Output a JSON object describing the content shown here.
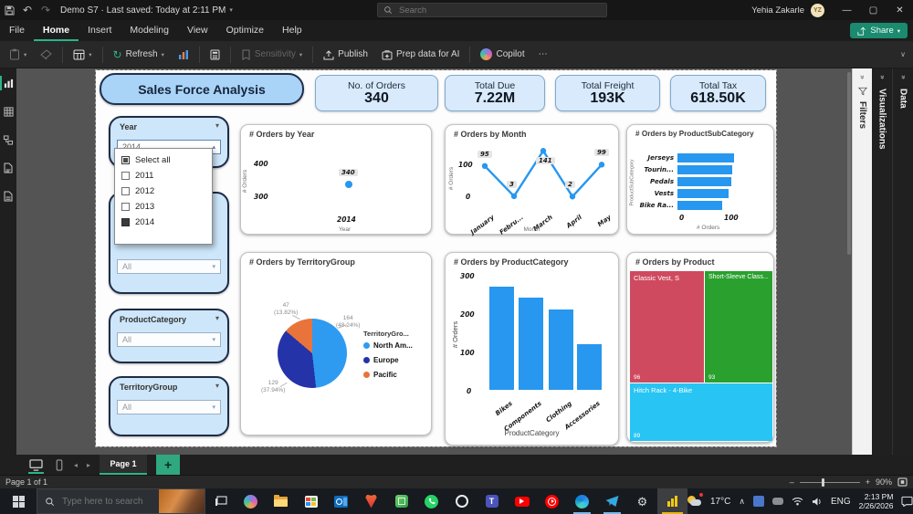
{
  "titlebar": {
    "doc_title": "Demo S7 · Last saved: Today at 2:11 PM",
    "search_placeholder": "Search",
    "user_name": "Yehia Zakarle",
    "user_initials": "YZ"
  },
  "menu": {
    "items": [
      {
        "label": "File"
      },
      {
        "label": "Home"
      },
      {
        "label": "Insert"
      },
      {
        "label": "Modeling"
      },
      {
        "label": "View"
      },
      {
        "label": "Optimize"
      },
      {
        "label": "Help"
      }
    ],
    "share_label": "Share"
  },
  "ribbon": {
    "refresh": "Refresh",
    "sensitivity": "Sensitivity",
    "publish": "Publish",
    "prep_ai": "Prep data for AI",
    "copilot": "Copilot",
    "more": "⋯"
  },
  "report": {
    "title": "Sales Force Analysis",
    "kpis": [
      {
        "label": "No. of Orders",
        "value": "340"
      },
      {
        "label": "Total Due",
        "value": "7.22M"
      },
      {
        "label": "Total Freight",
        "value": "193K"
      },
      {
        "label": "Total Tax",
        "value": "618.50K"
      }
    ],
    "slicers": {
      "year": {
        "title": "Year",
        "value": "2014",
        "options": [
          {
            "label": "Select all",
            "state": "partial"
          },
          {
            "label": "2011",
            "state": "empty"
          },
          {
            "label": "2012",
            "state": "empty"
          },
          {
            "label": "2013",
            "state": "empty"
          },
          {
            "label": "2014",
            "state": "checked"
          }
        ]
      },
      "hidden": {
        "value": "All"
      },
      "product_category": {
        "title": "ProductCategory",
        "value": "All"
      },
      "territory_group": {
        "title": "TerritoryGroup",
        "value": "All"
      }
    }
  },
  "chart_data": [
    {
      "type": "scatter",
      "title": "# Orders by Year",
      "xlabel": "Year",
      "ylabel": "# Orders",
      "x": [
        "2014"
      ],
      "y": [
        340
      ],
      "yticks": [
        "400",
        "300"
      ],
      "ylim": [
        250,
        450
      ]
    },
    {
      "type": "line",
      "title": "# Orders by Month",
      "xlabel": "Month",
      "ylabel": "# Orders",
      "categories": [
        "January",
        "Febru...",
        "March",
        "April",
        "May"
      ],
      "values": [
        95,
        3,
        141,
        2,
        99
      ],
      "yticks": [
        "100",
        "0"
      ],
      "ylim": [
        0,
        160
      ]
    },
    {
      "type": "bar",
      "title": "# Orders by ProductSubCategory",
      "xlabel": "# Orders",
      "ylabel": "ProductSubCategory",
      "categories": [
        "Jerseys",
        "Tourin...",
        "Pedals",
        "Vests",
        "Bike Ra..."
      ],
      "values": [
        110,
        108,
        106,
        100,
        87
      ],
      "xticks": [
        "0",
        "100"
      ],
      "xlim": [
        0,
        117
      ]
    },
    {
      "type": "pie",
      "title": "# Orders by TerritoryGroup",
      "legend_title": "TerritoryGro...",
      "slices": [
        {
          "label": "North Am...",
          "value": 164,
          "pct": "(48.24%)",
          "color": "#2e9bf0"
        },
        {
          "label": "Europe",
          "value": 129,
          "pct": "(37.94%)",
          "color": "#2433a8"
        },
        {
          "label": "Pacific",
          "value": 47,
          "pct": "(13.82%)",
          "color": "#e8743b"
        }
      ]
    },
    {
      "type": "column",
      "title": "# Orders by ProductCategory",
      "xlabel": "ProductCategory",
      "ylabel": "# Orders",
      "categories": [
        "Bikes",
        "Components",
        "Clothing",
        "Accessories"
      ],
      "values": [
        270,
        240,
        210,
        120
      ],
      "yticks": [
        "300",
        "200",
        "100",
        "0"
      ],
      "ylim": [
        0,
        300
      ]
    },
    {
      "type": "treemap",
      "title": "# Orders by Product",
      "items": [
        {
          "label": "Classic Vest, S",
          "value": 96,
          "color": "#cf4a5f"
        },
        {
          "label": "Short-Sleeve Class...",
          "value": 93,
          "color": "#2aa12e"
        },
        {
          "label": "Hitch Rack - 4-Bike",
          "value": 89,
          "color": "#27c4f4"
        }
      ]
    }
  ],
  "panes": {
    "filters": "Filters",
    "visualizations": "Visualizations",
    "data": "Data"
  },
  "pagebar": {
    "tab": "Page 1"
  },
  "statusbar": {
    "page_info": "Page 1 of 1",
    "zoom": "90%"
  },
  "taskbar": {
    "search_placeholder": "Type here to search",
    "temperature": "17°C",
    "language": "ENG",
    "time": "2:13 PM",
    "date": "2/26/2026"
  }
}
